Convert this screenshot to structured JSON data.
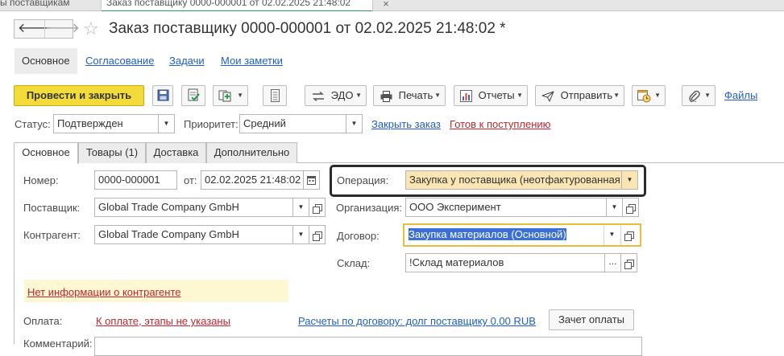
{
  "window_tabs": {
    "prev_label": "ы поставщикам",
    "active_label": "Заказ поставщику 0000-000001 от 02.02.2025 21:48:02",
    "close_glyph": "×"
  },
  "nav": {
    "back": "🡐",
    "forward": "🡒"
  },
  "header": {
    "star": "☆",
    "title": "Заказ поставщику 0000-000001 от 02.02.2025 21:48:02 *"
  },
  "form_tabs": [
    "Основное",
    "Согласование",
    "Задачи",
    "Мои заметки"
  ],
  "toolbar": {
    "post_close": "Провести и закрыть",
    "edo": "ЭДО",
    "print": "Печать",
    "reports": "Отчеты",
    "send": "Отправить",
    "files": "Файлы",
    "dropdown_glyph": "▼"
  },
  "status_row": {
    "status_label": "Статус:",
    "status_value": "Подтвержден",
    "priority_label": "Приоритет:",
    "priority_value": "Средний",
    "close_order": "Закрыть заказ",
    "ready_receipt": "Готов к поступлению"
  },
  "page_tabs": [
    "Основное",
    "Товары (1)",
    "Доставка",
    "Дополнительно"
  ],
  "fields": {
    "number_label": "Номер:",
    "number_value": "0000-000001",
    "from_label": "от:",
    "date_value": "02.02.2025 21:48:02",
    "supplier_label": "Поставщик:",
    "supplier_value": "Global Trade Company GmbH",
    "counterparty_label": "Контрагент:",
    "counterparty_value": "Global Trade Company GmbH",
    "operation_label": "Операция:",
    "operation_value": "Закупка у поставщика (неотфактурованная",
    "organization_label": "Организация:",
    "organization_value": "ООО Эксперимент",
    "contract_label": "Договор:",
    "contract_value": " Закупка материалов (Основной)",
    "warehouse_label": "Склад:",
    "warehouse_value": "!Склад материалов",
    "ellipsis": "..."
  },
  "info": {
    "no_info": "Нет информации о контрагенте",
    "payment_label": "Оплата:",
    "payment_link": "К оплате, этапы не указаны",
    "settlements_link": "Расчеты по договору: долг поставщику 0.00 RUB",
    "offset_button": "Зачет оплаты",
    "comment_label": "Комментарий:"
  },
  "colors": {
    "accent_yellow": "#f3dc3a",
    "link_blue": "#1f5ec7",
    "link_red": "#c0262c",
    "operation_bg": "#fbe6b3",
    "focus_border": "#e8bd3c",
    "selection_blue": "#3a6fd8"
  }
}
